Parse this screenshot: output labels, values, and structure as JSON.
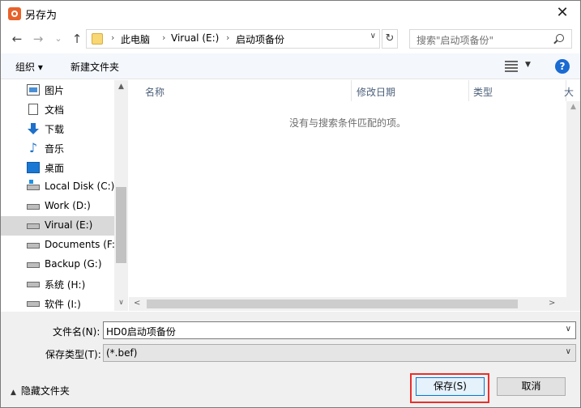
{
  "window": {
    "title": "另存为",
    "close_symbol": "✕"
  },
  "addressbar": {
    "back": "←",
    "forward": "→",
    "recent": "⌄",
    "up": "↑",
    "crumb_sep": "›",
    "crumbs": [
      "此电脑",
      "Virual (E:)",
      "启动项备份"
    ],
    "dropdown": "∨",
    "refresh": "↻",
    "search_placeholder": "搜索\"启动项备份\""
  },
  "toolbar": {
    "organize": "组织 ▾",
    "new_folder": "新建文件夹",
    "view_dropdown": "▼",
    "help": "?"
  },
  "navpane": {
    "items": [
      {
        "label": "图片",
        "icon": "pictures-icon"
      },
      {
        "label": "文档",
        "icon": "documents-icon"
      },
      {
        "label": "下载",
        "icon": "download-icon"
      },
      {
        "label": "音乐",
        "icon": "music-icon",
        "glyph": "♪"
      },
      {
        "label": "桌面",
        "icon": "desktop-icon"
      },
      {
        "label": "Local Disk (C:)",
        "icon": "system-drive-icon"
      },
      {
        "label": "Work (D:)",
        "icon": "drive-icon"
      },
      {
        "label": "Virual (E:)",
        "icon": "drive-icon",
        "selected": true
      },
      {
        "label": "Documents (F:)",
        "icon": "drive-icon"
      },
      {
        "label": "Backup (G:)",
        "icon": "drive-icon"
      },
      {
        "label": "系统 (H:)",
        "icon": "drive-icon"
      },
      {
        "label": "软件 (I:)",
        "icon": "drive-icon"
      }
    ],
    "scroll_up": "▲",
    "scroll_down": "∨"
  },
  "filelist": {
    "columns": [
      "名称",
      "修改日期",
      "类型",
      "大"
    ],
    "sort_indicator": "^",
    "empty_message": "没有与搜索条件匹配的项。",
    "scroll_up": "▲",
    "scroll_left": "<",
    "scroll_right": ">"
  },
  "form": {
    "filename_label": "文件名(N):",
    "filename_value": "HD0启动项备份",
    "filetype_label": "保存类型(T):",
    "filetype_value": "(*.bef)",
    "dropdown_arrow": "∨"
  },
  "footer": {
    "hide_folders": "隐藏文件夹",
    "hide_folders_caret": "▲",
    "save": "保存(S)",
    "cancel": "取消"
  },
  "colors": {
    "accent": "#0078d7",
    "highlight": "#e8302c",
    "help_icon": "#1a6bd2"
  }
}
